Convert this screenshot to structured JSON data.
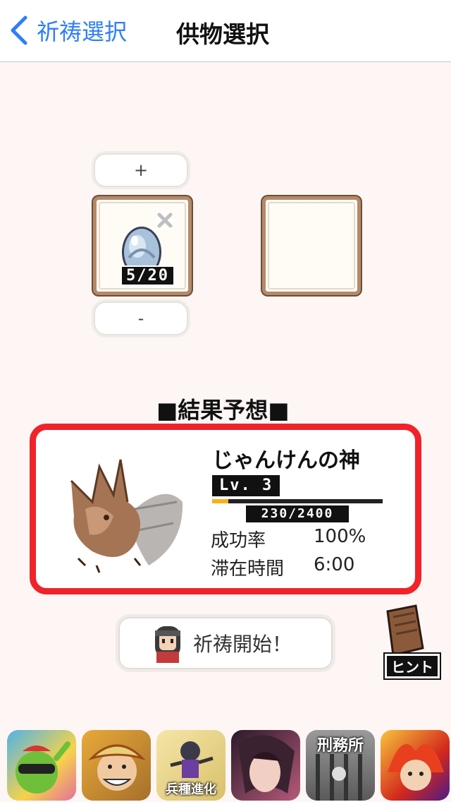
{
  "nav": {
    "back_label": "祈祷選択",
    "title": "供物選択"
  },
  "offering": {
    "plus_label": "+",
    "minus_label": "-",
    "slot1_count": "5/20",
    "slot1_item_icon": "egg-icon",
    "slot2_state": "empty"
  },
  "result": {
    "heading": "■結果予想■",
    "monster_name": "じゃんけんの神",
    "level_label": "Lv. 3",
    "exp_text": "230/2400",
    "exp_progress": 0.096,
    "success_rate_label": "成功率",
    "success_rate_value": "100%",
    "stay_time_label": "滞在時間",
    "stay_time_value": "6:00"
  },
  "start_button": {
    "label": "祈祷開始！"
  },
  "hint": {
    "label": "ヒント"
  },
  "ads": [
    {
      "icon": "green-character-app-icon",
      "text": ""
    },
    {
      "icon": "pirate-app-icon",
      "text": ""
    },
    {
      "icon": "ninja-app-icon",
      "text": "兵種進化"
    },
    {
      "icon": "romance-app-icon",
      "text": ""
    },
    {
      "icon": "prison-app-icon",
      "text": "刑務所"
    },
    {
      "icon": "fire-hero-app-icon",
      "text": ""
    }
  ],
  "colors": {
    "accent": "#2f7ef6",
    "card_border": "#f0232a",
    "background": "#fdf6f5",
    "exp_fill": "#f6b21b"
  }
}
